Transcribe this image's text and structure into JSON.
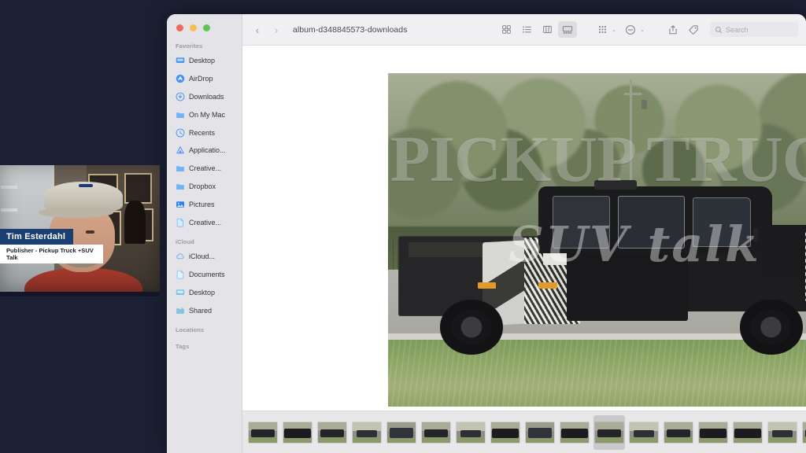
{
  "desktop": {
    "background_color": "#1b2033"
  },
  "window": {
    "title": "album-d348845573-downloads",
    "traffic_lights": [
      {
        "name": "close",
        "color": "#ed6a5f"
      },
      {
        "name": "minimize",
        "color": "#f4bf50"
      },
      {
        "name": "zoom",
        "color": "#61c554"
      }
    ]
  },
  "toolbar": {
    "back_label": "‹",
    "forward_label": "›",
    "view_buttons": [
      {
        "name": "icon-view",
        "label": "icon-view-icon",
        "active": false
      },
      {
        "name": "list-view",
        "label": "list-view-icon",
        "active": false
      },
      {
        "name": "column-view",
        "label": "column-view-icon",
        "active": false
      },
      {
        "name": "gallery-view",
        "label": "gallery-view-icon",
        "active": true
      }
    ],
    "group_label": "group-by-icon",
    "group_chevron": "⌄",
    "action_label": "action-menu-icon",
    "action_chevron": "⌄",
    "share_label": "share-icon",
    "tag_label": "tag-icon",
    "search_placeholder": "Search",
    "search_value": "",
    "search_icon": "search-icon"
  },
  "sidebar": {
    "sections": [
      {
        "title": "Favorites",
        "items": [
          {
            "label": "Desktop",
            "icon": "desktop-icon"
          },
          {
            "label": "AirDrop",
            "icon": "airdrop-icon"
          },
          {
            "label": "Downloads",
            "icon": "downloads-icon"
          },
          {
            "label": "On My Mac",
            "icon": "folder-icon"
          },
          {
            "label": "Recents",
            "icon": "clock-icon"
          },
          {
            "label": "Applicatio...",
            "icon": "applications-icon"
          },
          {
            "label": "Creative...",
            "icon": "folder-icon"
          },
          {
            "label": "Dropbox",
            "icon": "folder-icon"
          },
          {
            "label": "Pictures",
            "icon": "pictures-icon"
          },
          {
            "label": "Creative...",
            "icon": "document-icon"
          }
        ]
      },
      {
        "title": "iCloud",
        "items": [
          {
            "label": "iCloud...",
            "icon": "cloud-icon"
          },
          {
            "label": "Documents",
            "icon": "document-icon"
          },
          {
            "label": "Desktop",
            "icon": "desktop-icon"
          },
          {
            "label": "Shared",
            "icon": "shared-folder-icon"
          }
        ]
      },
      {
        "title": "Locations",
        "items": []
      },
      {
        "title": "Tags",
        "items": []
      }
    ]
  },
  "preview": {
    "watermark_line1": "PICKUP TRUCK",
    "watermark_line2": "SUV talk",
    "alt": "camouflaged black pickup truck prototype on a road"
  },
  "filmstrip": {
    "selected_index": 10,
    "thumbnails": [
      {
        "variant": "v1"
      },
      {
        "variant": "v2"
      },
      {
        "variant": "v1"
      },
      {
        "variant": "v3"
      },
      {
        "variant": "v4"
      },
      {
        "variant": "v1"
      },
      {
        "variant": "v3"
      },
      {
        "variant": "v2"
      },
      {
        "variant": "v4"
      },
      {
        "variant": "v2"
      },
      {
        "variant": "v1"
      },
      {
        "variant": "v3"
      },
      {
        "variant": "v1"
      },
      {
        "variant": "v2"
      },
      {
        "variant": "v2"
      },
      {
        "variant": "v3"
      },
      {
        "variant": "v1"
      }
    ]
  },
  "webcam": {
    "name": "Tim Esterdahl",
    "subtitle": "Publisher - Pickup Truck +SUV Talk",
    "name_bg": "#1c3f73",
    "subtitle_bg": "#ffffff"
  }
}
